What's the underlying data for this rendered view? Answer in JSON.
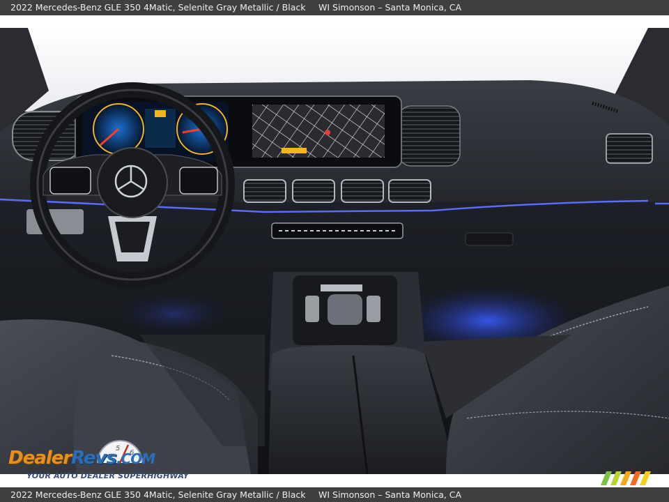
{
  "caption": {
    "vehicle": "2022 Mercedes-Benz GLE 350 4Matic,  Selenite Gray Metallic / Black",
    "dealer": "WI Simonson – Santa Monica, CA"
  },
  "watermark": {
    "word_dealer": "Dealer",
    "word_revs": "Revs",
    "word_com": ".COM",
    "tagline": "YOUR AUTO DEALER SUPERHIGHWAY",
    "gauge_numbers": "4 5 6"
  },
  "colors": {
    "caption_bar": "#3f3f3f",
    "ambient_light": "#3a5bff",
    "logo_orange": "#e8901c",
    "logo_blue": "#2a6fb5"
  }
}
